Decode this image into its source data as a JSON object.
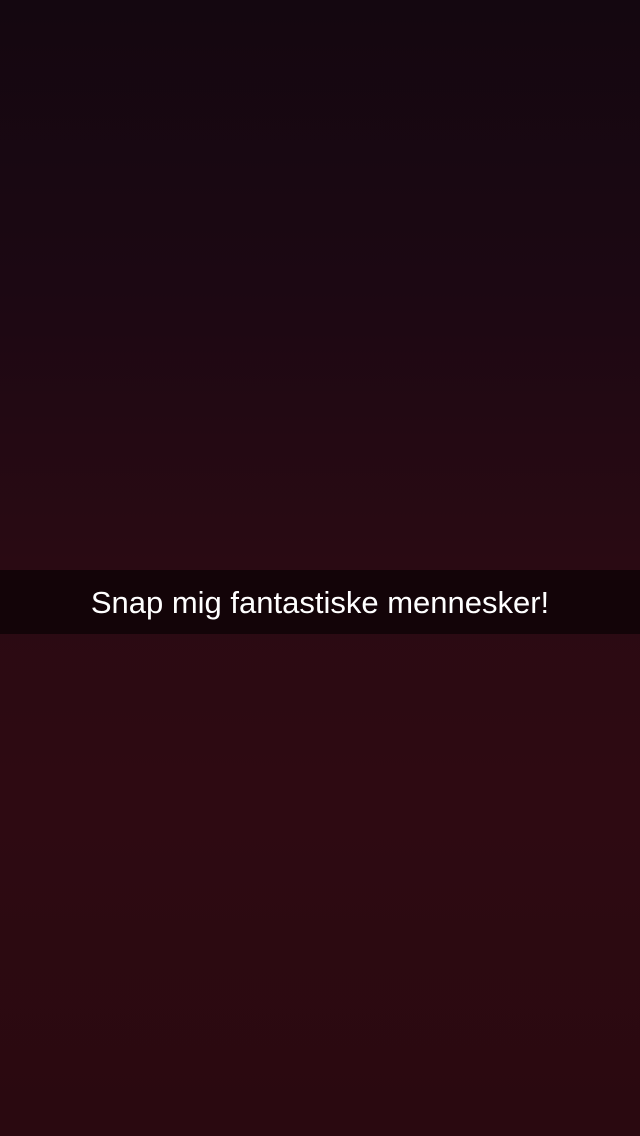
{
  "snap": {
    "caption": "Snap mig fantastiske mennesker!"
  },
  "colors": {
    "background_top": "#140710",
    "background_bottom": "#2a0910",
    "caption_bar": "rgba(0,0,0,0.55)",
    "caption_text": "#ffffff"
  }
}
